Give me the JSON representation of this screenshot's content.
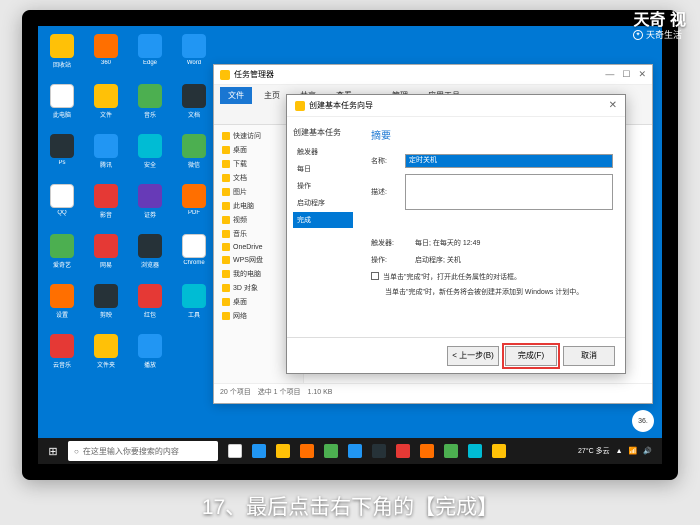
{
  "watermark": {
    "main": "天奇 视",
    "sub": "天奇生活"
  },
  "caption": "17、最后点击右下角的【完成】",
  "desktop_icons": [
    {
      "label": "回收站",
      "cls": "bg-yellow"
    },
    {
      "label": "360",
      "cls": "bg-orange"
    },
    {
      "label": "Edge",
      "cls": "bg-blue"
    },
    {
      "label": "Word",
      "cls": "bg-blue"
    },
    {
      "label": "此电脑",
      "cls": "bg-white"
    },
    {
      "label": "文件",
      "cls": "bg-yellow"
    },
    {
      "label": "音乐",
      "cls": "bg-green"
    },
    {
      "label": "文档",
      "cls": "bg-dark"
    },
    {
      "label": "Ps",
      "cls": "bg-dark"
    },
    {
      "label": "腾讯",
      "cls": "bg-blue"
    },
    {
      "label": "安全",
      "cls": "bg-cyan"
    },
    {
      "label": "微信",
      "cls": "bg-green"
    },
    {
      "label": "QQ",
      "cls": "bg-white"
    },
    {
      "label": "影音",
      "cls": "bg-red"
    },
    {
      "label": "证券",
      "cls": "bg-purple"
    },
    {
      "label": "PDF",
      "cls": "bg-orange"
    },
    {
      "label": "爱奇艺",
      "cls": "bg-green"
    },
    {
      "label": "网易",
      "cls": "bg-red"
    },
    {
      "label": "浏览器",
      "cls": "bg-dark"
    },
    {
      "label": "Chrome",
      "cls": "bg-white"
    },
    {
      "label": "设置",
      "cls": "bg-orange"
    },
    {
      "label": "剪映",
      "cls": "bg-dark"
    },
    {
      "label": "红包",
      "cls": "bg-red"
    },
    {
      "label": "工具",
      "cls": "bg-cyan"
    },
    {
      "label": "云音乐",
      "cls": "bg-red"
    },
    {
      "label": "文件夹",
      "cls": "bg-yellow"
    },
    {
      "label": "播放",
      "cls": "bg-blue"
    },
    {
      "label": "",
      "cls": ""
    }
  ],
  "file_mgr": {
    "title": "任务管理器",
    "tabs": {
      "file": "文件",
      "main": "主页",
      "share": "共享",
      "view": "查看",
      "manage": "管理",
      "tools": "应用工具"
    },
    "side_items": [
      "快速访问",
      "桌面",
      "下载",
      "文档",
      "图片",
      "此电脑",
      "视频",
      "音乐",
      "OneDrive",
      "WPS网盘",
      "我的电脑",
      "3D 对象",
      "桌面",
      "网络"
    ],
    "status": "20 个项目　选中 1 个项目　1.10 KB"
  },
  "wizard": {
    "title": "创建基本任务向导",
    "heading": "摘要",
    "nav_hdr": "创建基本任务",
    "nav_items": [
      "触发器",
      "每日",
      "操作",
      "启动程序",
      "完成"
    ],
    "name_lbl": "名称:",
    "name_val": "定时关机",
    "desc_lbl": "描述:",
    "trigger_lbl": "触发器:",
    "trigger_val": "每日; 在每天的 12:49",
    "action_lbl": "操作:",
    "action_val": "启动程序; 关机",
    "checkbox_note": "当单击\"完成\"时，打开此任务属性的对话框。",
    "finish_note": "当单击\"完成\"时，新任务将会被创建并添加到 Windows 计划中。",
    "btn_back": "< 上一步(B)",
    "btn_finish": "完成(F)",
    "btn_cancel": "取消"
  },
  "taskbar": {
    "search_placeholder": "在这里输入你要搜索的内容",
    "weather": "27°C 多云",
    "badge": "36."
  }
}
